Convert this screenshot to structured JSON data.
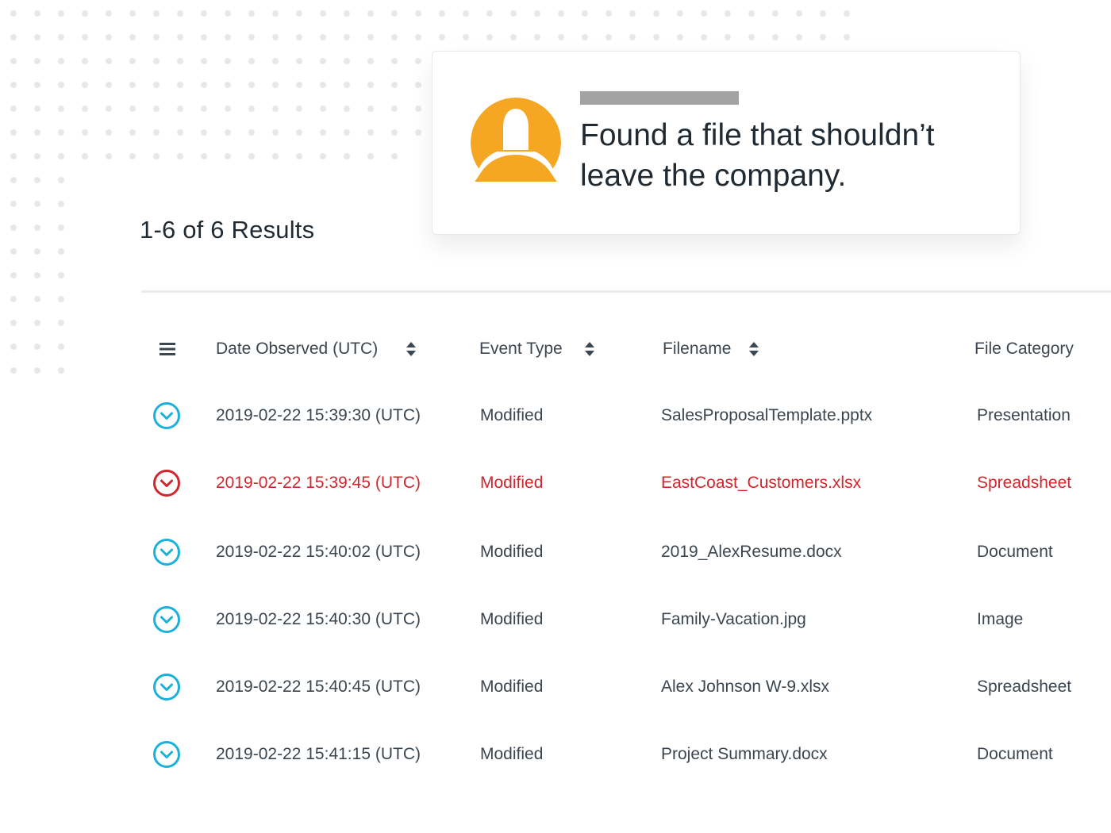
{
  "colors": {
    "accent": "#1cb0dc",
    "alert": "#d0262d",
    "avatar": "#f5a623",
    "text": "#3b4650",
    "dots": "#e6e8eb"
  },
  "alert": {
    "message": "Found a file that shouldn’t leave the company.",
    "avatar_icon": "user-avatar-icon"
  },
  "results": {
    "count_label": "1-6 of 6 Results"
  },
  "table": {
    "headers": {
      "date": "Date Observed (UTC)",
      "event": "Event Type",
      "filename": "Filename",
      "category": "File Category"
    },
    "rows": [
      {
        "date": "2019-02-22 15:39:30 (UTC)",
        "event": "Modified",
        "filename": "SalesProposalTemplate.pptx",
        "category": "Presentation",
        "flagged": false
      },
      {
        "date": "2019-02-22 15:39:45 (UTC)",
        "event": "Modified",
        "filename": "EastCoast_Customers.xlsx",
        "category": "Spreadsheet",
        "flagged": true
      },
      {
        "date": "2019-02-22 15:40:02 (UTC)",
        "event": "Modified",
        "filename": "2019_AlexResume.docx",
        "category": "Document",
        "flagged": false
      },
      {
        "date": "2019-02-22 15:40:30 (UTC)",
        "event": "Modified",
        "filename": "Family-Vacation.jpg",
        "category": "Image",
        "flagged": false
      },
      {
        "date": "2019-02-22 15:40:45 (UTC)",
        "event": "Modified",
        "filename": "Alex Johnson W-9.xlsx",
        "category": "Spreadsheet",
        "flagged": false
      },
      {
        "date": "2019-02-22 15:41:15 (UTC)",
        "event": "Modified",
        "filename": "Project Summary.docx",
        "category": "Document",
        "flagged": false
      }
    ]
  }
}
